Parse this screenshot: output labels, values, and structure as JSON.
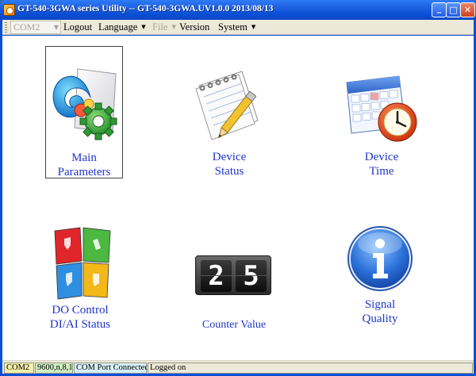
{
  "window": {
    "title": "GT-540-3GWA series Utility -- GT-540-3GWA.UV1.0.0 2013/08/13",
    "minimize_glyph": "_",
    "maximize_glyph": "□",
    "close_glyph": "✕"
  },
  "menubar": {
    "port_select": "COM2",
    "items": [
      {
        "label": "Logout"
      },
      {
        "label": "Language",
        "arrow": "▼"
      },
      {
        "label": "File",
        "arrow": "▼"
      },
      {
        "label": "Version"
      },
      {
        "label": "System",
        "arrow": "▼"
      }
    ]
  },
  "tiles": {
    "main_parameters": {
      "line1": "Main",
      "line2": "Parameters",
      "icon": "settings-gear-icon"
    },
    "device_status": {
      "line1": "Device",
      "line2": "Status",
      "icon": "notepad-pencil-icon"
    },
    "device_time": {
      "line1": "Device",
      "line2": "Time",
      "icon": "calendar-clock-icon"
    },
    "do_control": {
      "line1": "DO Control",
      "line2": "DI/AI Status",
      "icon": "switch-blocks-icon"
    },
    "counter_value": {
      "line1": "Counter Value",
      "digits": [
        "2",
        "5"
      ],
      "icon": "counter-display-icon"
    },
    "signal_quality": {
      "line1": "Signal",
      "line2": "Quality",
      "icon": "info-icon"
    }
  },
  "statusbar": {
    "port": "COM2",
    "settings": "9600,n,8,1",
    "connection": "COM Port Connected",
    "login": "Logged on"
  },
  "colors": {
    "titlebar": "#0a4fd6",
    "label_blue": "#1f35c9",
    "statusbar_port_bg": "#f2f0a8",
    "statusbar_settings_bg": "#cfeec0",
    "statusbar_connection_bg": "#d6f0f6"
  }
}
